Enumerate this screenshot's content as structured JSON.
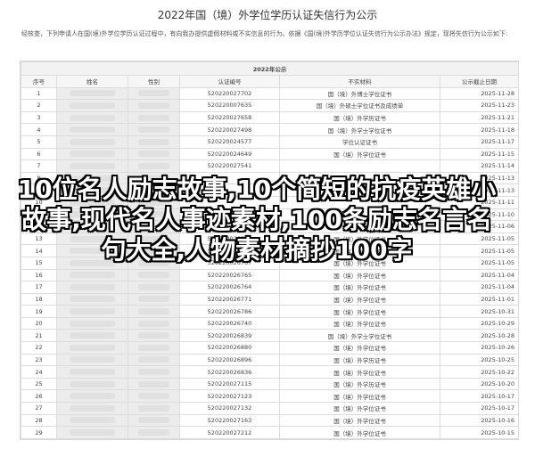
{
  "page": {
    "title": "2022年国（境）外学位学历认证失信行为公示",
    "intro": "经核查，下列申请人在国(境)外学位学历认证过程中，有向我办提供虚假材料或不实信息的行为。依据《国(境)外学历学位认证失信行为公示办法》规定，现将失信行为公示如下:"
  },
  "table": {
    "caption": "2022年公示",
    "columns": [
      "序号",
      "姓名",
      "性别",
      "认证编号",
      "不实材料",
      "公示截止日期"
    ],
    "rows": [
      {
        "no": "1",
        "cert": "520220027702",
        "type": "国（境）外博士学位证书",
        "date": "2025-11-28"
      },
      {
        "no": "2",
        "cert": "520220007635",
        "type": "国（境）外硕士学位证书及成绩单",
        "date": "2025-11-23"
      },
      {
        "no": "3",
        "cert": "520220027658",
        "type": "国（境）外学历证书",
        "date": "2025-11-21"
      },
      {
        "no": "4",
        "cert": "520220027498",
        "type": "国（境）外学士学位证书",
        "date": "2025-11-18"
      },
      {
        "no": "5",
        "cert": "520220024577",
        "type": "学位认证证书",
        "date": "2025-11-17"
      },
      {
        "no": "6",
        "cert": "520220024649",
        "type": "国（境）外学位证书",
        "date": "2025-11-15"
      },
      {
        "no": "7",
        "cert": "520220027541",
        "type": "",
        "date": "2025-11-14"
      },
      {
        "no": "8",
        "cert": "",
        "type": "",
        "date": "2025-11-13"
      },
      {
        "no": "9",
        "cert": "",
        "type": "",
        "date": "2025-11-13"
      },
      {
        "no": "10",
        "cert": "",
        "type": "",
        "date": "2025-11-11"
      },
      {
        "no": "11",
        "cert": "",
        "type": "",
        "date": "2025-11-10"
      },
      {
        "no": "12",
        "cert": "",
        "type": "",
        "date": "2025-11-06"
      },
      {
        "no": "13",
        "cert": "520220026760",
        "type": "国（境）外学位证书",
        "date": "2025-11-05"
      },
      {
        "no": "14",
        "cert": "520220026761",
        "type": "国（境）外学位证书",
        "date": "2025-11-05"
      },
      {
        "no": "15",
        "cert": "520220026767",
        "type": "国（境）外学位证书",
        "date": "2025-11-05"
      },
      {
        "no": "16",
        "cert": "520220026765",
        "type": "国（境）外学位证书",
        "date": "2025-11-04"
      },
      {
        "no": "17",
        "cert": "520220026764",
        "type": "国（境）外学位证书",
        "date": "2025-11-04"
      },
      {
        "no": "18",
        "cert": "520220026771",
        "type": "国（境）外学位证书",
        "date": "2025-11-01"
      },
      {
        "no": "19",
        "cert": "520220026786",
        "type": "国（境）外学位证书",
        "date": "2025-10-31"
      },
      {
        "no": "20",
        "cert": "520220026740",
        "type": "国（境）外学位证书",
        "date": "2025-10-29"
      },
      {
        "no": "21",
        "cert": "520220026839",
        "type": "国（境）外学士学位证书",
        "date": "2025-10-28"
      },
      {
        "no": "22",
        "cert": "520220026880",
        "type": "国（境）外学位证书",
        "date": "2025-10-26"
      },
      {
        "no": "23",
        "cert": "520220026896",
        "type": "国（境）外学历证书",
        "date": "2025-10-25"
      },
      {
        "no": "24",
        "cert": "520220026836",
        "type": "国（境）外学位证书",
        "date": "2025-10-22"
      },
      {
        "no": "25",
        "cert": "520220027115",
        "type": "国（境）外学历证书",
        "date": "2025-10-20"
      },
      {
        "no": "26",
        "cert": "520220027123",
        "type": "国（境）外学位证书",
        "date": "2025-10-17"
      },
      {
        "no": "27",
        "cert": "520220027132",
        "type": "国（境）外学位证书",
        "date": "2025-10-17"
      },
      {
        "no": "28",
        "cert": "520220027163",
        "type": "国（境）外学位证书",
        "date": "2025-10-16"
      },
      {
        "no": "29",
        "cert": "520220027212",
        "type": "国（境）外学位证书",
        "date": "2025-10-15"
      }
    ]
  },
  "overlay": {
    "caption": "10位名人励志故事,10个简短的抗疫英雄小故事,现代名人事迹素材,100条励志名言名句大全,人物素材摘抄100字"
  }
}
